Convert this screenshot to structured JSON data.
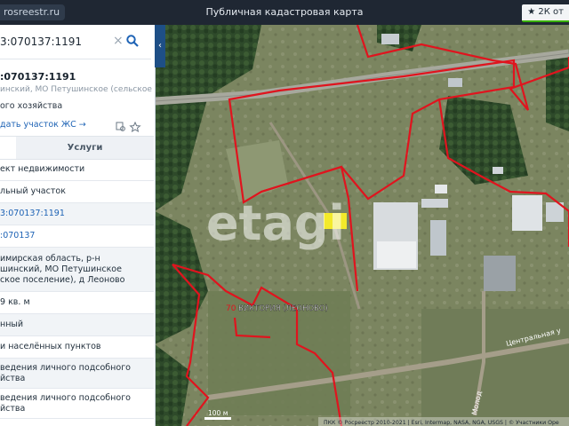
{
  "topbar": {
    "url": "rosreestr.ru",
    "title": "Публичная кадастровая карта",
    "right_button": "★ 2К от"
  },
  "panel": {
    "search_value": "3:070137:1191",
    "cadastral_title": ":070137:1191",
    "subtitle": "инский, МО Петушинское (сельское",
    "purpose": "ого хозяйства",
    "add_link": "дать участок ЖС →",
    "tabs": {
      "active": "",
      "services": "Услуги"
    },
    "rows": [
      "ект недвижимости",
      "льный участок",
      "3:070137:1191",
      ":070137",
      "имирская область, р-н\nшинский, МО Петушинское\nское поселение), д Леоново",
      "9 кв. м",
      "нный",
      "и населённых пунктов",
      "ведения личного подсобного\nйства",
      "ведения личного подсобного\nйства"
    ]
  },
  "map": {
    "watermark": "etagi",
    "place_label": "ВИКТОРИЯ (ЛЕОНОВО)",
    "num_label": "70",
    "street_label": "Центральная у",
    "street_label2": "Молод",
    "scale": "100 м",
    "attribution": "ПКК © Росреестр 2010-2021 | Esri, Intermap, NASA, NGA, USGS | © Участники Ope"
  },
  "colors": {
    "accent": "#1e63b5",
    "boundary": "#e0141e",
    "highlight": "#f3ea2a",
    "topbar": "#1f2733"
  }
}
